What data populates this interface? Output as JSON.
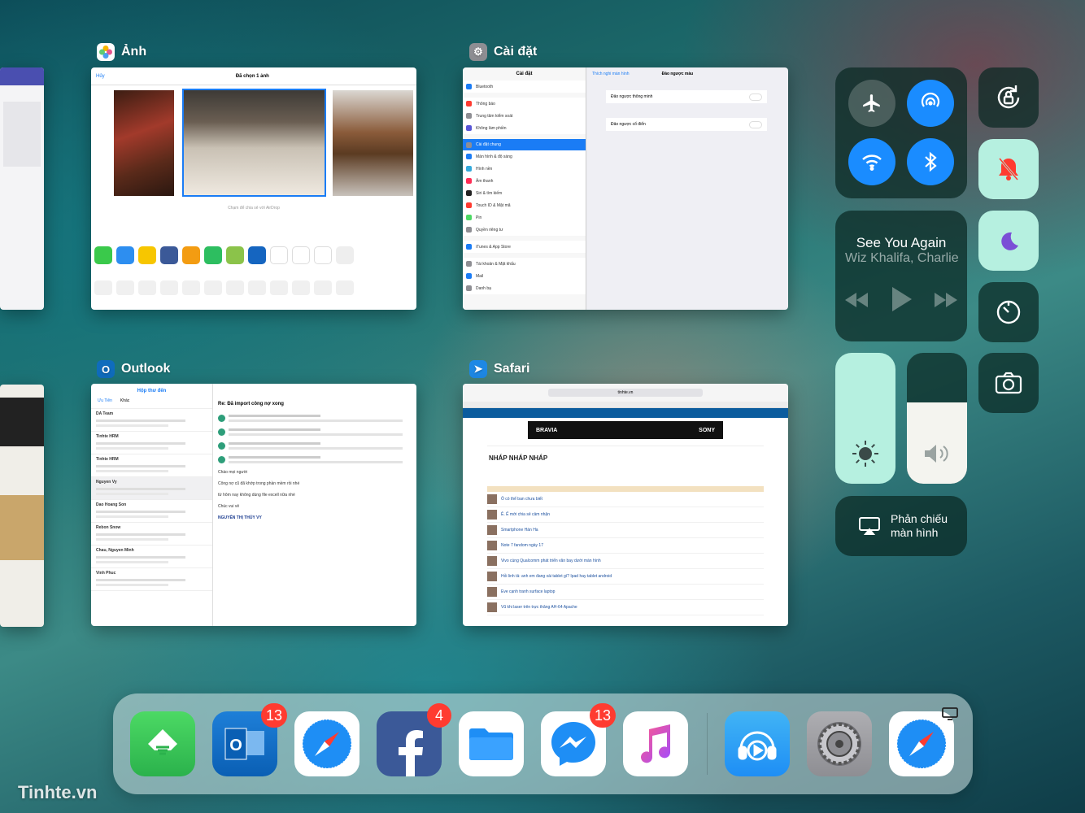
{
  "switcher": {
    "photos": {
      "title": "Ảnh",
      "header_left": "Hủy",
      "header_center": "Đã chọn 1 ảnh",
      "hint": "Chạm để chia sẻ với AirDrop"
    },
    "settings": {
      "title": "Cài đặt",
      "left_header": "Cài đặt",
      "back_label": "Thích nghi màn hình",
      "right_header": "Đảo ngược màu",
      "items": [
        "Bluetooth",
        "Thông báo",
        "Trung tâm kiểm soát",
        "Không làm phiền",
        "Cài đặt chung",
        "Màn hình & độ sáng",
        "Hình nền",
        "Âm thanh",
        "Siri & tìm kiếm",
        "Touch ID & Mật mã",
        "Pin",
        "Quyền riêng tư",
        "iTunes & App Store",
        "Tài khoản & Mật khẩu",
        "Mail",
        "Danh bạ"
      ],
      "toggle1": "Đảo ngược thông minh",
      "toggle2": "Đảo ngược cổ điển"
    },
    "outlook": {
      "title": "Outlook",
      "header": "Hộp thư đến",
      "tab1": "Ưu Tiên",
      "tab2": "Khác",
      "subject": "Re: Đã import công nợ xong",
      "senders": [
        "DA Team",
        "Tinhte HRM",
        "Tinhte HRM",
        "Nguyen Vy",
        "Dao Hoang Son",
        "Rebon Snow",
        "Chau, Nguyen Minh",
        "Vinh Phuc"
      ],
      "body_lines": [
        "Chào mọi người",
        "Công nợ cũ đã khớp trong phần mềm rồi nhé",
        "từ hôm nay không dùng file excell nữa nhé",
        "Chúc vui vẻ"
      ],
      "signature": "NGUYỄN THỊ THÚY VY"
    },
    "safari": {
      "title": "Safari",
      "url": "tinhte.vn",
      "page_title": "NHÁP NHÁP NHÁP",
      "banner_left": "BRAVIA",
      "banner_right": "SONY",
      "threads": [
        "Ô có thể ban chưa biết",
        "Ê. Ế mới chia sẻ cảm nhận",
        "Smartphone Hàn Ha",
        "Note 7 fandom ngày 17",
        "Vivo cùng Qualcomm phát triển văn bay dưới màn hình",
        "Hỏi linh tả: anh em đang xài tablet gì? Ipad hay tablet android",
        "Eve cạnh tranh surface laptop",
        "Vũ khi laser trên trực thăng AH-64 Apache"
      ]
    }
  },
  "control_center": {
    "music_title": "See You Again",
    "music_artist": "Wiz Khalifa, Charlie",
    "airplay_line1": "Phản chiếu",
    "airplay_line2": "màn hình",
    "colors": {
      "blue": "#1a8cff",
      "mint": "#b6f0e0",
      "active_dark": "rgba(10,40,35,0.72)"
    }
  },
  "dock": {
    "badges": {
      "outlook": "13",
      "facebook": "4",
      "messenger": "13"
    }
  },
  "watermark": "Tinhte.vn"
}
